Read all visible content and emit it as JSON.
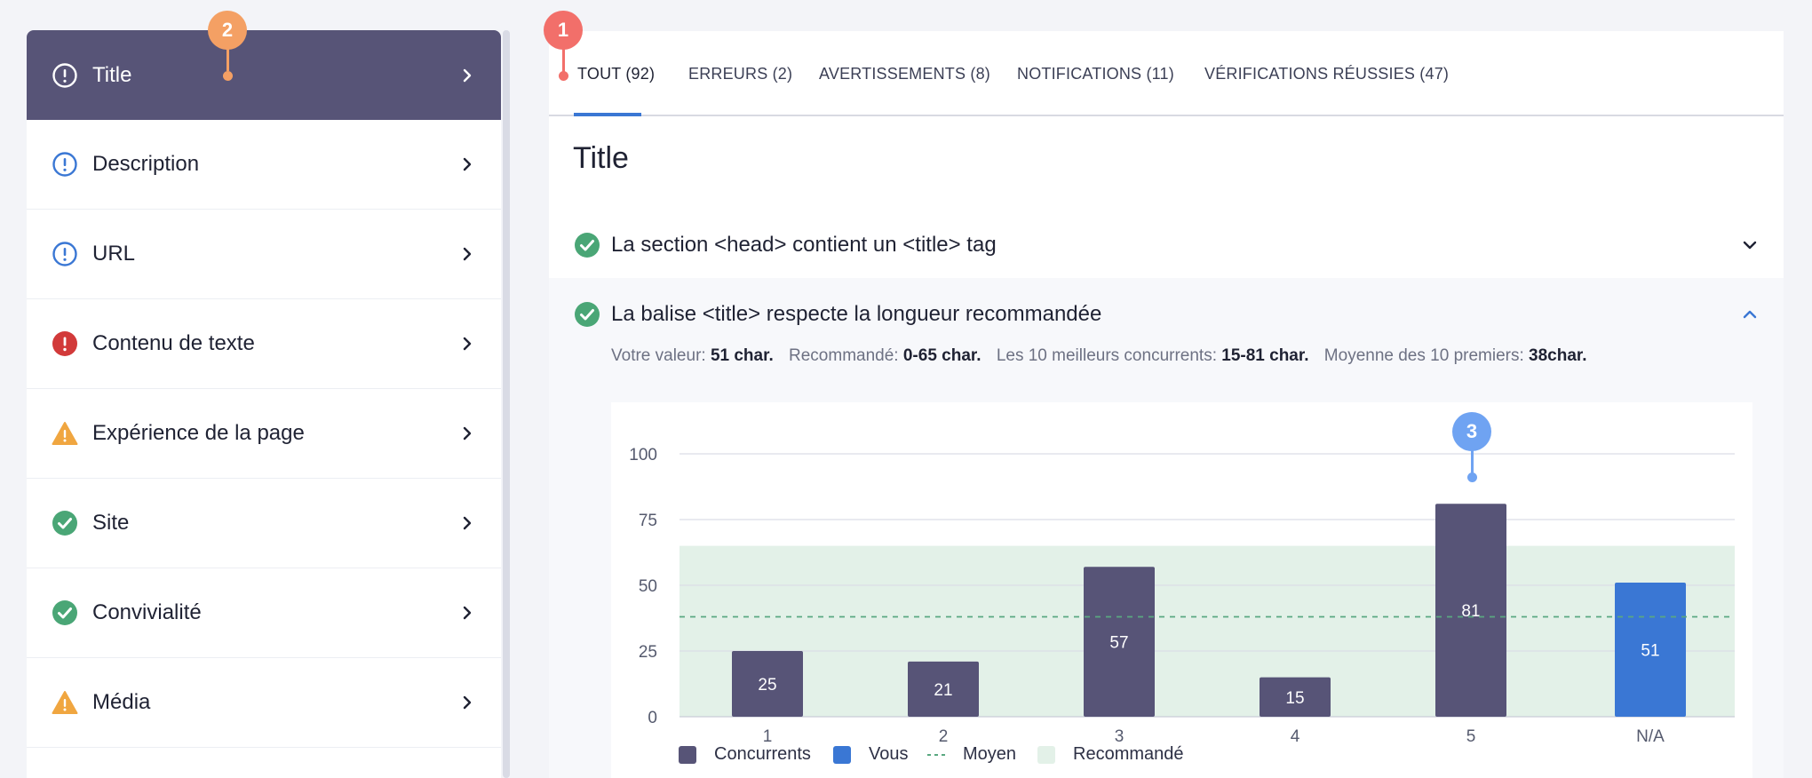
{
  "sidebar": {
    "items": [
      {
        "label": "Title",
        "icon": "info-icon",
        "status": "info",
        "active": true
      },
      {
        "label": "Description",
        "icon": "info-icon",
        "status": "info"
      },
      {
        "label": "URL",
        "icon": "info-icon",
        "status": "info"
      },
      {
        "label": "Contenu de texte",
        "icon": "error-icon",
        "status": "error"
      },
      {
        "label": "Expérience de la page",
        "icon": "warning-icon",
        "status": "warning"
      },
      {
        "label": "Site",
        "icon": "check-icon",
        "status": "pass"
      },
      {
        "label": "Convivialité",
        "icon": "check-icon",
        "status": "pass"
      },
      {
        "label": "Média",
        "icon": "warning-icon",
        "status": "warning"
      }
    ]
  },
  "tabs": [
    {
      "label": "TOUT (92)",
      "active": true
    },
    {
      "label": "ERREURS (2)"
    },
    {
      "label": "AVERTISSEMENTS (8)"
    },
    {
      "label": "NOTIFICATIONS (11)"
    },
    {
      "label": "VÉRIFICATIONS RÉUSSIES (47)"
    }
  ],
  "page_title": "Title",
  "checks": [
    {
      "text": "La section <head> contient un <title> tag",
      "expanded": false
    },
    {
      "text": "La balise <title> respecte la longueur recommandée",
      "expanded": true
    }
  ],
  "stats": {
    "your_label": "Votre valeur:",
    "your_value": "51 char.",
    "rec_label": "Recommandé:",
    "rec_value": "0-65 char.",
    "top_label": "Les 10 meilleurs concurrents:",
    "top_value": "15-81 char.",
    "avg_label": "Moyenne des 10 premiers:",
    "avg_value": "38char."
  },
  "badges": [
    "1",
    "2",
    "3"
  ],
  "colors": {
    "competitor": "#575477",
    "you": "#3a77d4",
    "recommended": "#e3f1e8",
    "average": "#5aa881",
    "badge_red": "#f26f6a",
    "badge_orange": "#f4a064",
    "badge_blue": "#6fa3f2"
  },
  "chart_data": {
    "type": "bar",
    "categories": [
      "1",
      "2",
      "3",
      "4",
      "5",
      "N/A"
    ],
    "series": [
      {
        "name": "Concurrents",
        "values": [
          25,
          21,
          57,
          15,
          81,
          null
        ]
      },
      {
        "name": "Vous",
        "values": [
          null,
          null,
          null,
          null,
          null,
          51
        ]
      }
    ],
    "yticks": [
      0,
      25,
      50,
      75,
      100
    ],
    "ylim": [
      0,
      100
    ],
    "average": 38,
    "recommended_range": [
      0,
      65
    ],
    "legend": [
      "Concurrents",
      "Vous",
      "Moyen",
      "Recommandé"
    ],
    "grid": true,
    "legend_position": "bottom-left"
  }
}
